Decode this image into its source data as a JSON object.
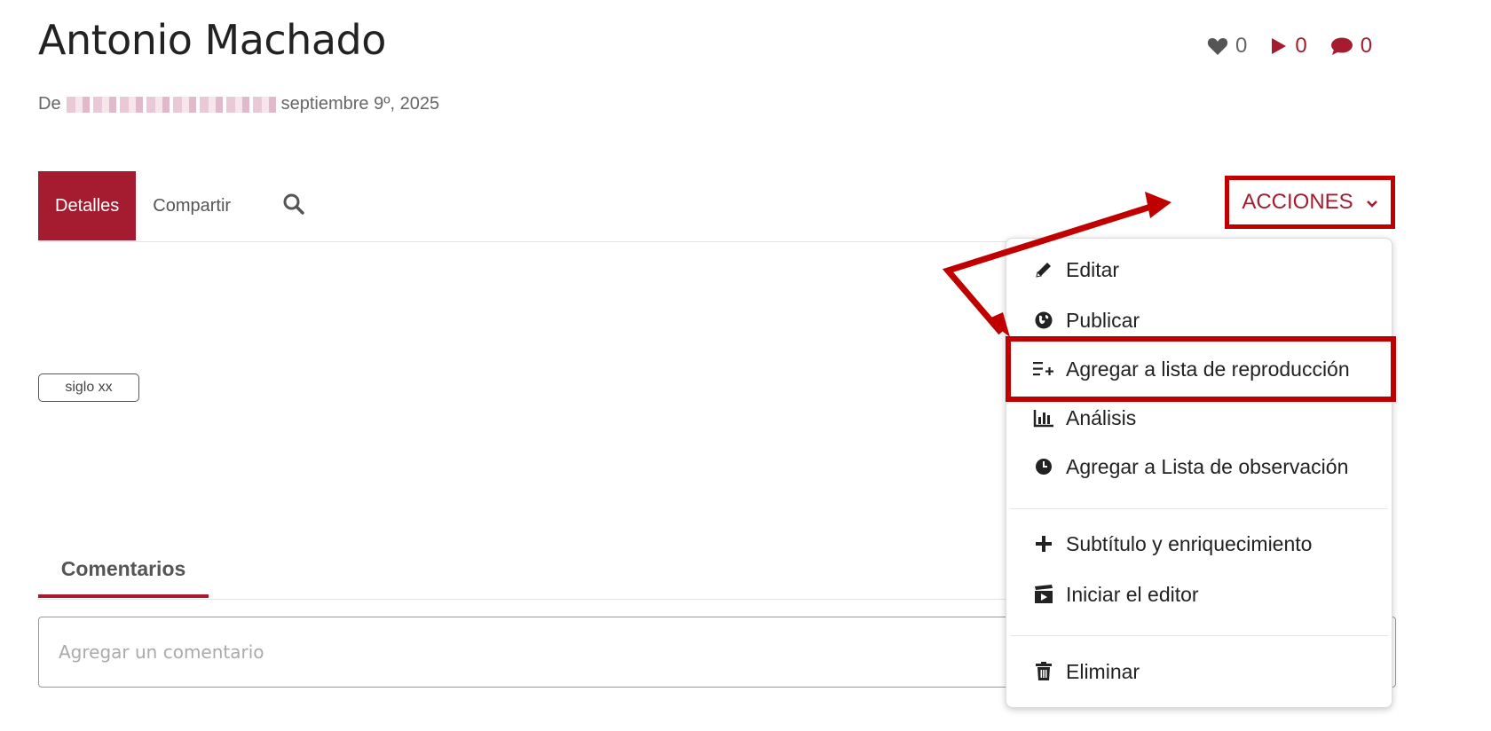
{
  "header": {
    "title": "Antonio Machado",
    "byline_prefix": "De",
    "date": "septiembre 9º, 2025"
  },
  "stats": {
    "likes": "0",
    "plays": "0",
    "comments": "0"
  },
  "tabs": [
    {
      "label": "Detalles",
      "active": true
    },
    {
      "label": "Compartir",
      "active": false
    }
  ],
  "actions": {
    "label": "ACCIONES",
    "menu": [
      {
        "label": "Editar",
        "icon": "pencil-icon"
      },
      {
        "label": "Publicar",
        "icon": "globe-icon"
      },
      {
        "label": "Agregar a lista de reproducción",
        "icon": "playlist-add-icon"
      },
      {
        "label": "Análisis",
        "icon": "bar-chart-icon"
      },
      {
        "label": "Agregar a Lista de observación",
        "icon": "clock-icon"
      },
      {
        "label": "Subtítulo y enriquecimiento",
        "icon": "plus-icon"
      },
      {
        "label": "Iniciar el editor",
        "icon": "clapperboard-icon"
      },
      {
        "label": "Eliminar",
        "icon": "trash-icon"
      }
    ]
  },
  "tags": [
    "siglo xx"
  ],
  "comments": {
    "tab_label": "Comentarios",
    "placeholder": "Agregar un comentario"
  },
  "colors": {
    "brand": "#a51c30",
    "annotation": "#c00000"
  }
}
